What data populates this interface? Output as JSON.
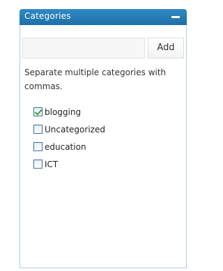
{
  "panel": {
    "title": "Categories",
    "collapse_icon": "minus-icon"
  },
  "form": {
    "input_value": "",
    "input_placeholder": "",
    "add_label": "Add"
  },
  "help": {
    "text": "Separate multiple categories with commas."
  },
  "categories": [
    {
      "label": "blogging",
      "checked": true
    },
    {
      "label": "Uncategorized",
      "checked": false
    },
    {
      "label": "education",
      "checked": false
    },
    {
      "label": "ICT",
      "checked": false
    }
  ],
  "colors": {
    "header": "#2f89c3",
    "border": "#b6d3e4",
    "check": "#2fa52f"
  }
}
